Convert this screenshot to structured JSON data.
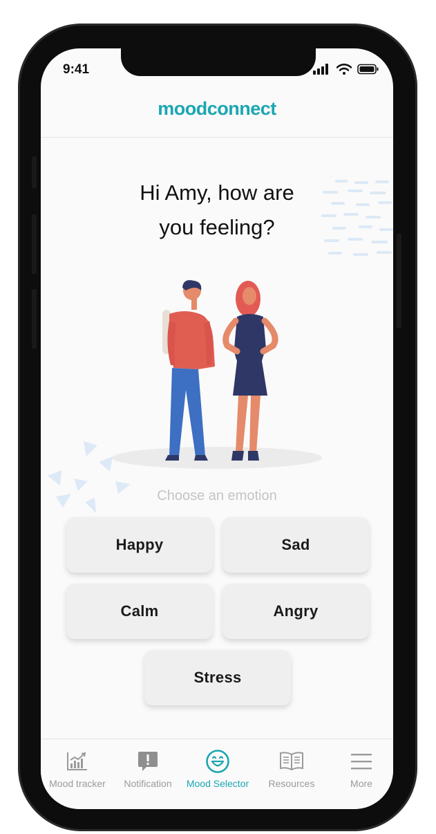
{
  "status_bar": {
    "time": "9:41"
  },
  "header": {
    "logo": "moodconnect"
  },
  "greeting": {
    "line1": "Hi Amy, how are",
    "line2": "you feeling?"
  },
  "emotions": {
    "prompt": "Choose an emotion",
    "items": [
      "Happy",
      "Sad",
      "Calm",
      "Angry",
      "Stress"
    ]
  },
  "nav": {
    "items": [
      {
        "label": "Mood tracker",
        "icon": "chart-icon",
        "active": false
      },
      {
        "label": "Notification",
        "icon": "alert-icon",
        "active": false
      },
      {
        "label": "Mood Selector",
        "icon": "smiley-icon",
        "active": true
      },
      {
        "label": "Resources",
        "icon": "book-icon",
        "active": false
      },
      {
        "label": "More",
        "icon": "menu-icon",
        "active": false
      }
    ]
  },
  "colors": {
    "accent": "#1ba6b2",
    "inactive": "#9a9a9a",
    "button_bg": "#efefef"
  }
}
